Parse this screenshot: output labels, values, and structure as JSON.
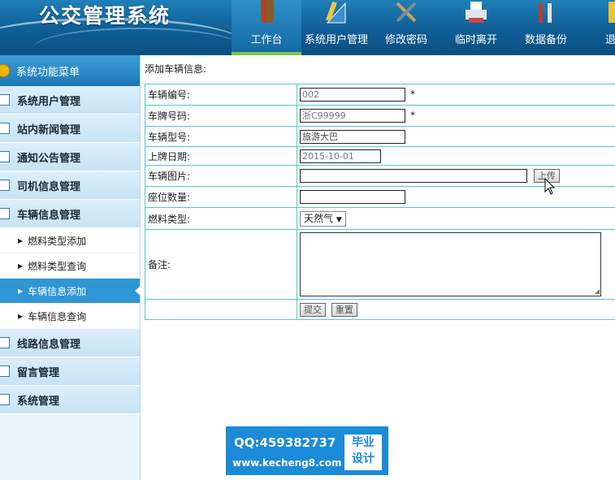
{
  "header": {
    "app_title": "公交管理系统",
    "nav": [
      {
        "label": "工作台",
        "icon": "book-icon",
        "active": true
      },
      {
        "label": "系统用户管理",
        "icon": "ruler-triangle-icon",
        "active": false
      },
      {
        "label": "修改密码",
        "icon": "tools-icon",
        "active": false
      },
      {
        "label": "临时离开",
        "icon": "printer-icon",
        "active": false
      },
      {
        "label": "数据备份",
        "icon": "wrench-icon",
        "active": false
      },
      {
        "label": "退出",
        "icon": "exit-icon",
        "active": false
      }
    ]
  },
  "sidebar": {
    "title": "系统功能菜单",
    "groups": [
      {
        "label": "系统用户管理",
        "icon": "list-icon"
      },
      {
        "label": "站内新闻管理",
        "icon": "chat-icon"
      },
      {
        "label": "通知公告管理",
        "icon": "edit-icon"
      },
      {
        "label": "司机信息管理",
        "icon": "calendar-icon"
      },
      {
        "label": "车辆信息管理",
        "icon": "list-icon"
      }
    ],
    "sub_items": [
      {
        "label": "燃料类型添加",
        "active": false
      },
      {
        "label": "燃料类型查询",
        "active": false
      },
      {
        "label": "车辆信息添加",
        "active": true
      },
      {
        "label": "车辆信息查询",
        "active": false
      }
    ],
    "groups_after": [
      {
        "label": "线路信息管理",
        "icon": "list-icon"
      },
      {
        "label": "留言管理",
        "icon": "edit-icon"
      },
      {
        "label": "系统管理",
        "icon": "calendar-icon"
      }
    ]
  },
  "form": {
    "title": "添加车辆信息:",
    "fields": {
      "vehicle_no": {
        "label": "车辆编号:",
        "value": "002",
        "required_mark": "*"
      },
      "plate_no": {
        "label": "车牌号码:",
        "value": "浙C99999",
        "required_mark": "*"
      },
      "model": {
        "label": "车辆型号:",
        "value": "旅游大巴"
      },
      "reg_date": {
        "label": "上牌日期:",
        "value": "2015-10-01"
      },
      "photo": {
        "label": "车辆图片:",
        "value": "",
        "button": "上传"
      },
      "seats": {
        "label": "座位数量:",
        "value": ""
      },
      "fuel": {
        "label": "燃料类型:",
        "selected": "天然气"
      },
      "notes": {
        "label": "备注:",
        "value": ""
      }
    },
    "submit_label": "提交",
    "reset_label": "重置"
  },
  "watermark": {
    "qq": "QQ:459382737",
    "url": "www.kecheng8.com",
    "badge_line1": "毕业",
    "badge_line2": "设计"
  }
}
